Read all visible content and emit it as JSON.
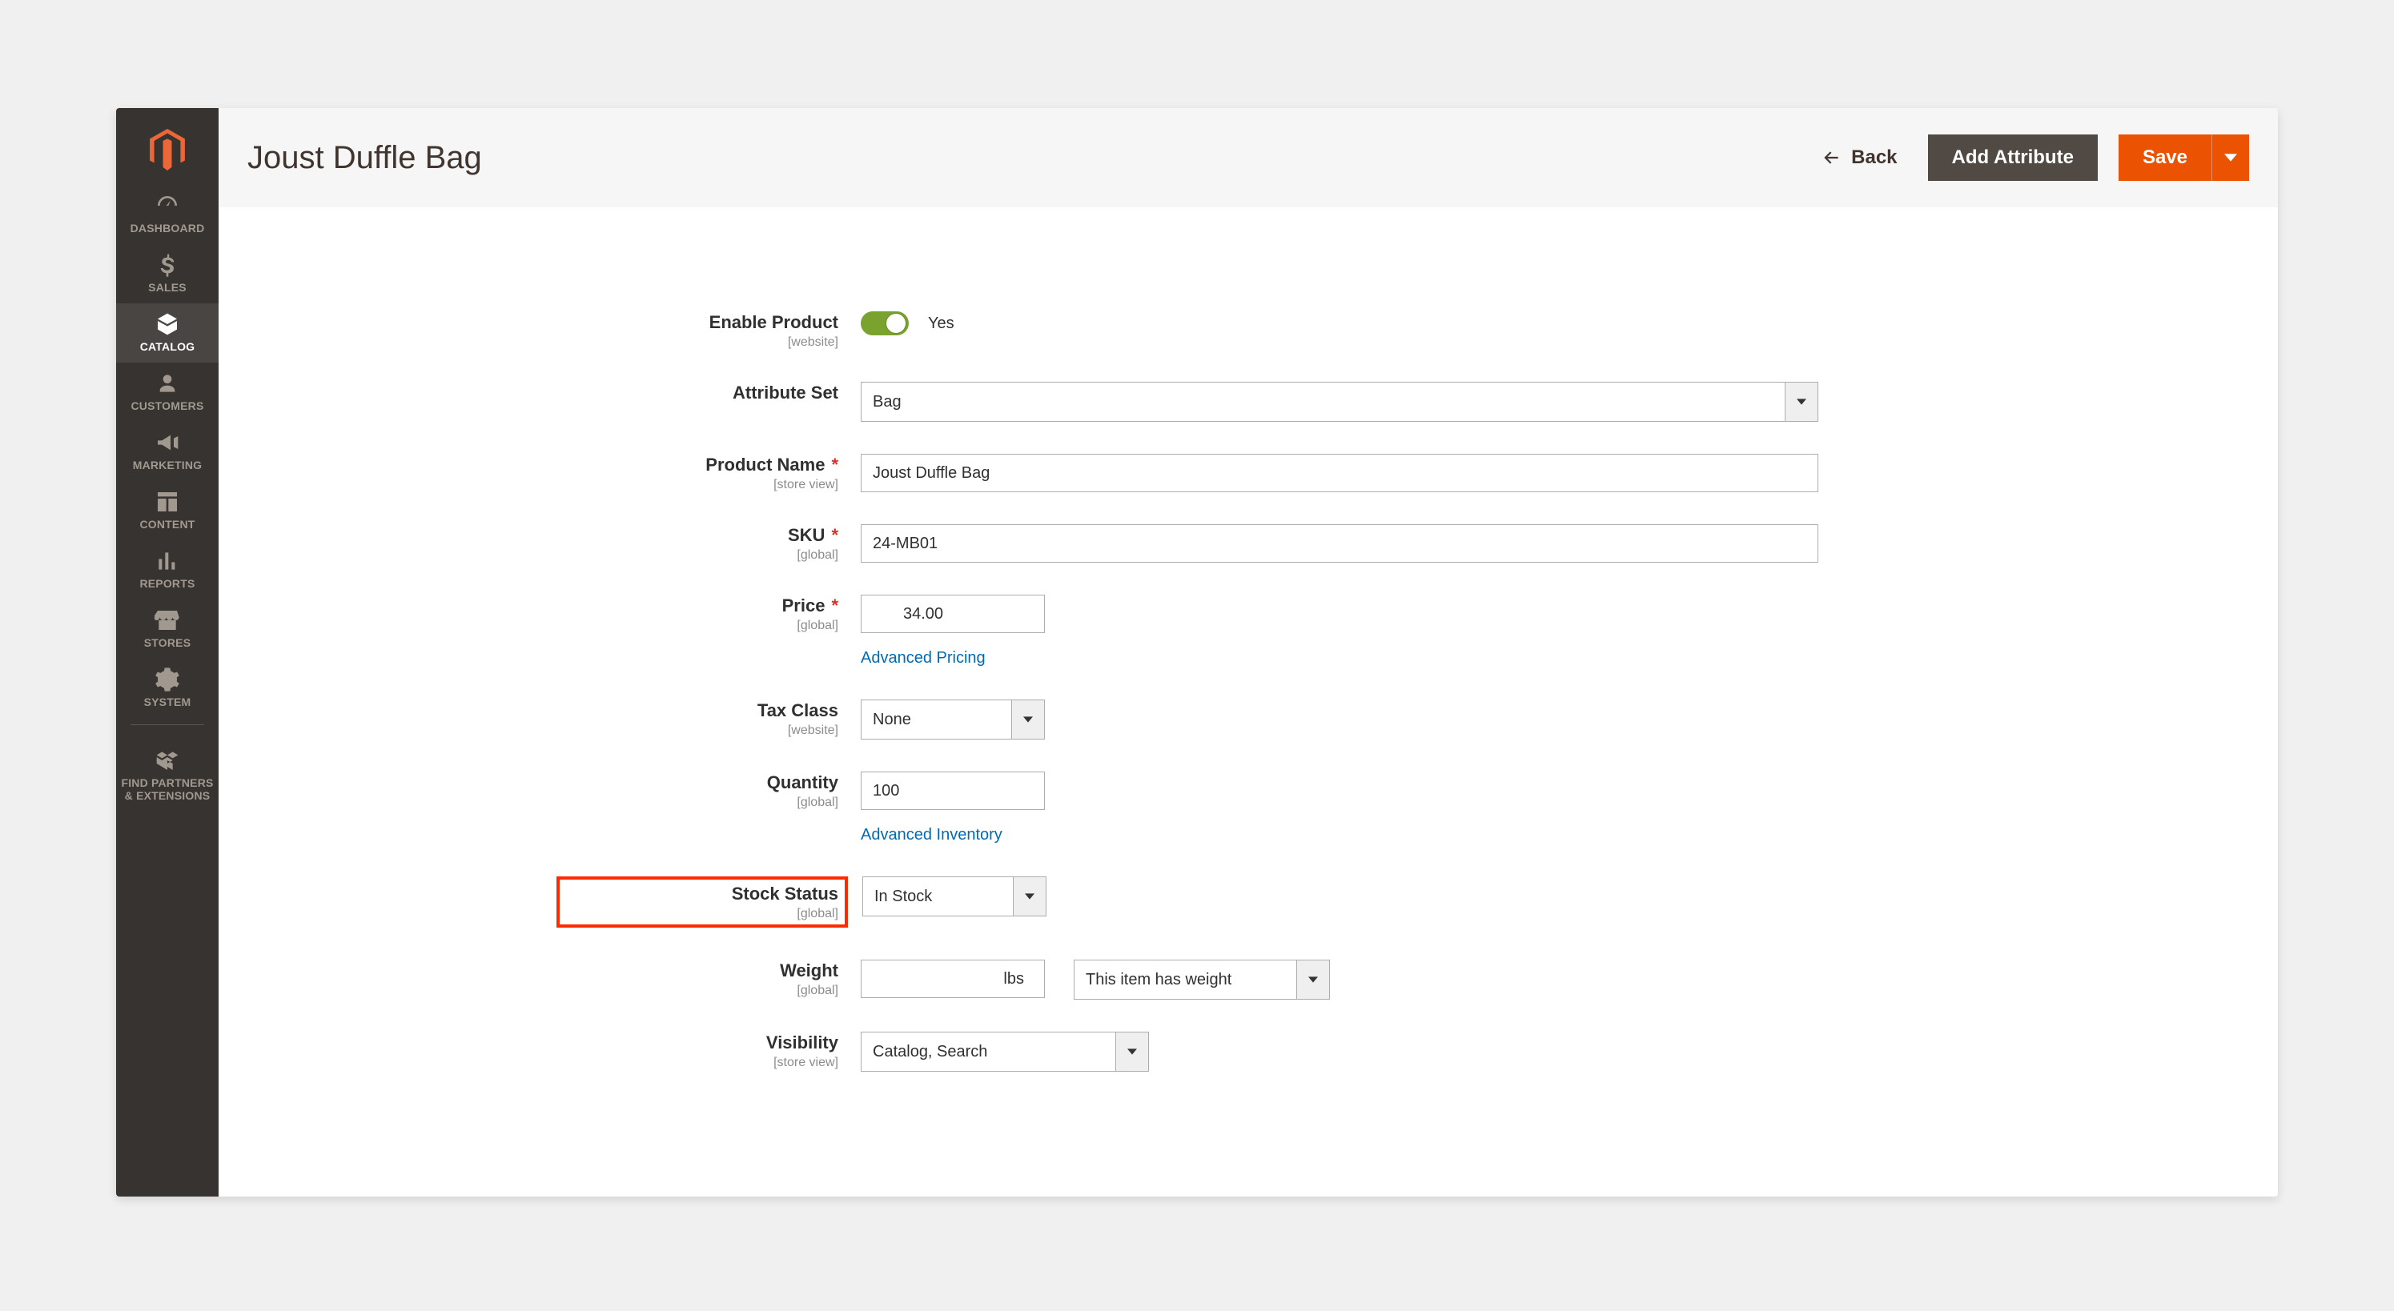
{
  "sidebar": {
    "items": [
      {
        "label": "DASHBOARD",
        "icon": "dashboard"
      },
      {
        "label": "SALES",
        "icon": "dollar"
      },
      {
        "label": "CATALOG",
        "icon": "box",
        "active": true
      },
      {
        "label": "CUSTOMERS",
        "icon": "person"
      },
      {
        "label": "MARKETING",
        "icon": "megaphone"
      },
      {
        "label": "CONTENT",
        "icon": "layout"
      },
      {
        "label": "REPORTS",
        "icon": "bars"
      },
      {
        "label": "STORES",
        "icon": "storefront"
      },
      {
        "label": "SYSTEM",
        "icon": "gear"
      },
      {
        "label": "FIND PARTNERS\n& EXTENSIONS",
        "icon": "boxes",
        "twoLine": true
      }
    ]
  },
  "header": {
    "title": "Joust Duffle Bag",
    "back_label": "Back",
    "add_attribute_label": "Add Attribute",
    "save_label": "Save"
  },
  "form": {
    "enable_product": {
      "label": "Enable Product",
      "scope": "[website]",
      "value_label": "Yes",
      "value": true
    },
    "attribute_set": {
      "label": "Attribute Set",
      "value": "Bag"
    },
    "product_name": {
      "label": "Product Name",
      "scope": "[store view]",
      "required": true,
      "value": "Joust Duffle Bag"
    },
    "sku": {
      "label": "SKU",
      "scope": "[global]",
      "required": true,
      "value": "24-MB01"
    },
    "price": {
      "label": "Price",
      "scope": "[global]",
      "required": true,
      "currency": "$",
      "value": "34.00",
      "advanced_link": "Advanced Pricing"
    },
    "tax_class": {
      "label": "Tax Class",
      "scope": "[website]",
      "value": "None"
    },
    "quantity": {
      "label": "Quantity",
      "scope": "[global]",
      "value": "100",
      "advanced_link": "Advanced Inventory"
    },
    "stock_status": {
      "label": "Stock Status",
      "scope": "[global]",
      "value": "In Stock",
      "highlight": true
    },
    "weight": {
      "label": "Weight",
      "scope": "[global]",
      "value": "",
      "unit": "lbs",
      "has_weight": "This item has weight"
    },
    "visibility": {
      "label": "Visibility",
      "scope": "[store view]",
      "value": "Catalog, Search"
    },
    "required_mark": "*"
  },
  "icons": {
    "caret_down": "▼"
  }
}
